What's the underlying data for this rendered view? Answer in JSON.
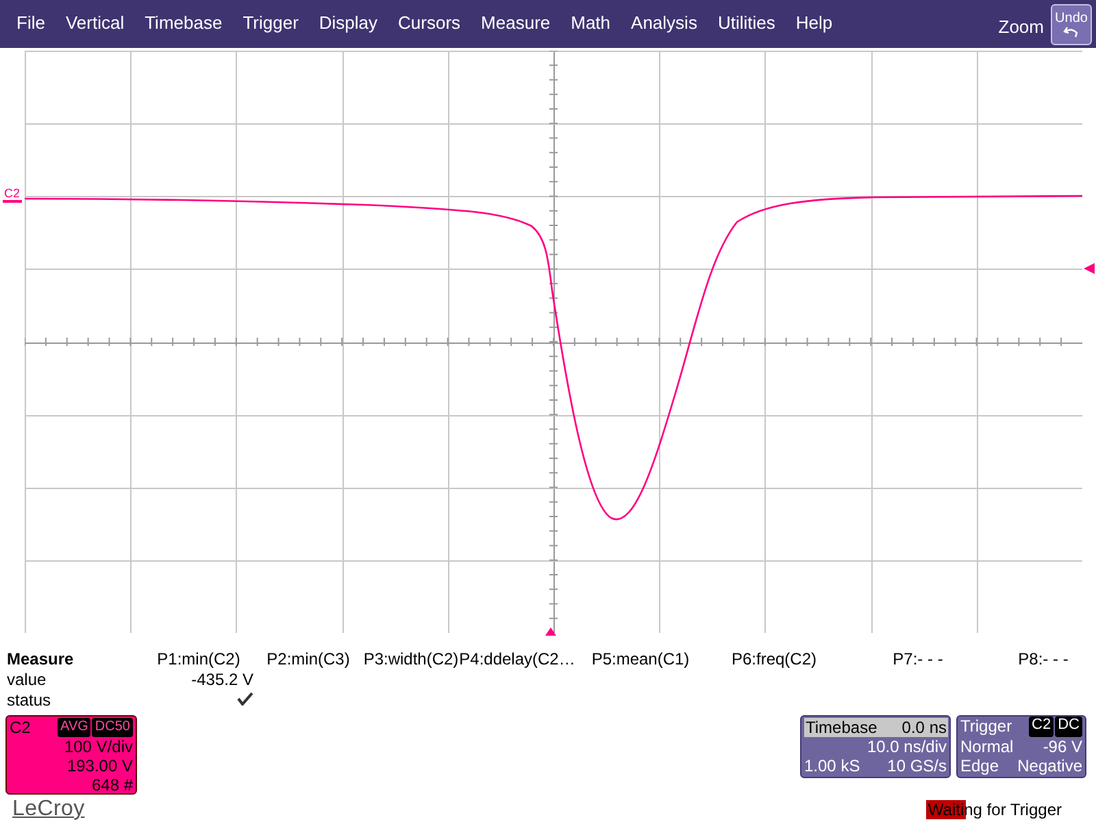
{
  "menu": {
    "items": [
      "File",
      "Vertical",
      "Timebase",
      "Trigger",
      "Display",
      "Cursors",
      "Measure",
      "Math",
      "Analysis",
      "Utilities",
      "Help"
    ],
    "zoom": "Zoom",
    "undo": "Undo"
  },
  "graticule": {
    "channel_marker": "C2"
  },
  "measure": {
    "title": "Measure",
    "row_labels": [
      "value",
      "status"
    ],
    "params": [
      {
        "label": "P1:min(C2)",
        "value": "-435.2 V",
        "checked": true
      },
      {
        "label": "P2:min(C3)",
        "checked": false
      },
      {
        "label": "P3:width(C2)",
        "checked": false
      },
      {
        "label": "P4:ddelay(C2…",
        "checked": false
      },
      {
        "label": "P5:mean(C1)",
        "checked": false
      },
      {
        "label": "P6:freq(C2)",
        "checked": false
      },
      {
        "label": "P7:- - -",
        "checked": false
      },
      {
        "label": "P8:- - -",
        "checked": false
      }
    ]
  },
  "channel": {
    "name": "C2",
    "color": "#ff0080",
    "tags": [
      "AVG",
      "DC50"
    ],
    "lines": [
      "100 V/div",
      "193.00 V",
      "648 #"
    ]
  },
  "timebase": {
    "title": "Timebase",
    "offset": "0.0 ns",
    "rows": [
      [
        "",
        "10.0 ns/div"
      ],
      [
        "1.00 kS",
        "10 GS/s"
      ]
    ]
  },
  "trigger": {
    "title": "Trigger",
    "tags": [
      "C2",
      "DC"
    ],
    "rows": [
      [
        "Normal",
        "-96 V"
      ],
      [
        "Edge",
        "Negative"
      ]
    ]
  },
  "logo": "LeCroy",
  "status": {
    "text": "Waiting for Trigger",
    "level": 0.29
  }
}
